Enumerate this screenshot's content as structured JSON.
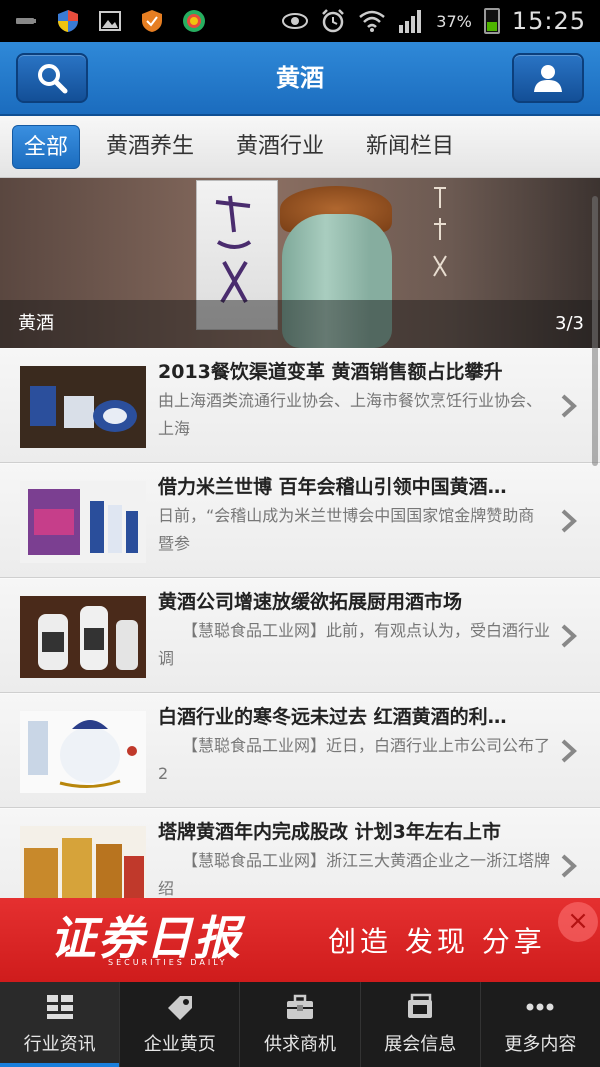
{
  "status_bar": {
    "battery": "37%",
    "time": "15:25"
  },
  "header": {
    "title": "黄酒"
  },
  "tabs": [
    {
      "label": "全部",
      "active": true
    },
    {
      "label": "黄酒养生",
      "active": false
    },
    {
      "label": "黄酒行业",
      "active": false
    },
    {
      "label": "新闻栏目",
      "active": false
    }
  ],
  "banner": {
    "caption": "黄酒",
    "page_indicator": "3/3"
  },
  "news": [
    {
      "title": "2013餐饮渠道变革 黄酒销售额占比攀升",
      "desc": "由上海酒类流通行业协会、上海市餐饮烹饪行业协会、上海"
    },
    {
      "title": "借力米兰世博 百年会稽山引领中国黄酒…",
      "desc": "日前，“会稽山成为米兰世博会中国国家馆金牌赞助商暨参"
    },
    {
      "title": "黄酒公司增速放缓欲拓展厨用酒市场",
      "desc": "　　【慧聪食品工业网】此前，有观点认为，受白酒行业调"
    },
    {
      "title": "白酒行业的寒冬远未过去 红酒黄酒的利…",
      "desc": "　　【慧聪食品工业网】近日，白酒行业上市公司公布了2"
    },
    {
      "title": "塔牌黄酒年内完成股改 计划3年左右上市",
      "desc": "　　【慧聪食品工业网】浙江三大黄酒企业之一浙江塔牌绍"
    }
  ],
  "ad": {
    "logo": "证券日报",
    "logo_sub": "SECURITIES DAILY",
    "slogan": "创造 发现 分享",
    "close": "×"
  },
  "bottom_nav": [
    {
      "label": "行业资讯",
      "icon": "grid-icon",
      "active": true
    },
    {
      "label": "企业黄页",
      "icon": "tag-icon",
      "active": false
    },
    {
      "label": "供求商机",
      "icon": "briefcase-icon",
      "active": false
    },
    {
      "label": "展会信息",
      "icon": "ticket-icon",
      "active": false
    },
    {
      "label": "更多内容",
      "icon": "more-icon",
      "active": false
    }
  ],
  "colors": {
    "header_blue": "#1b6cbe",
    "ad_red": "#e02020",
    "nav_active": "#1a7fdc"
  }
}
